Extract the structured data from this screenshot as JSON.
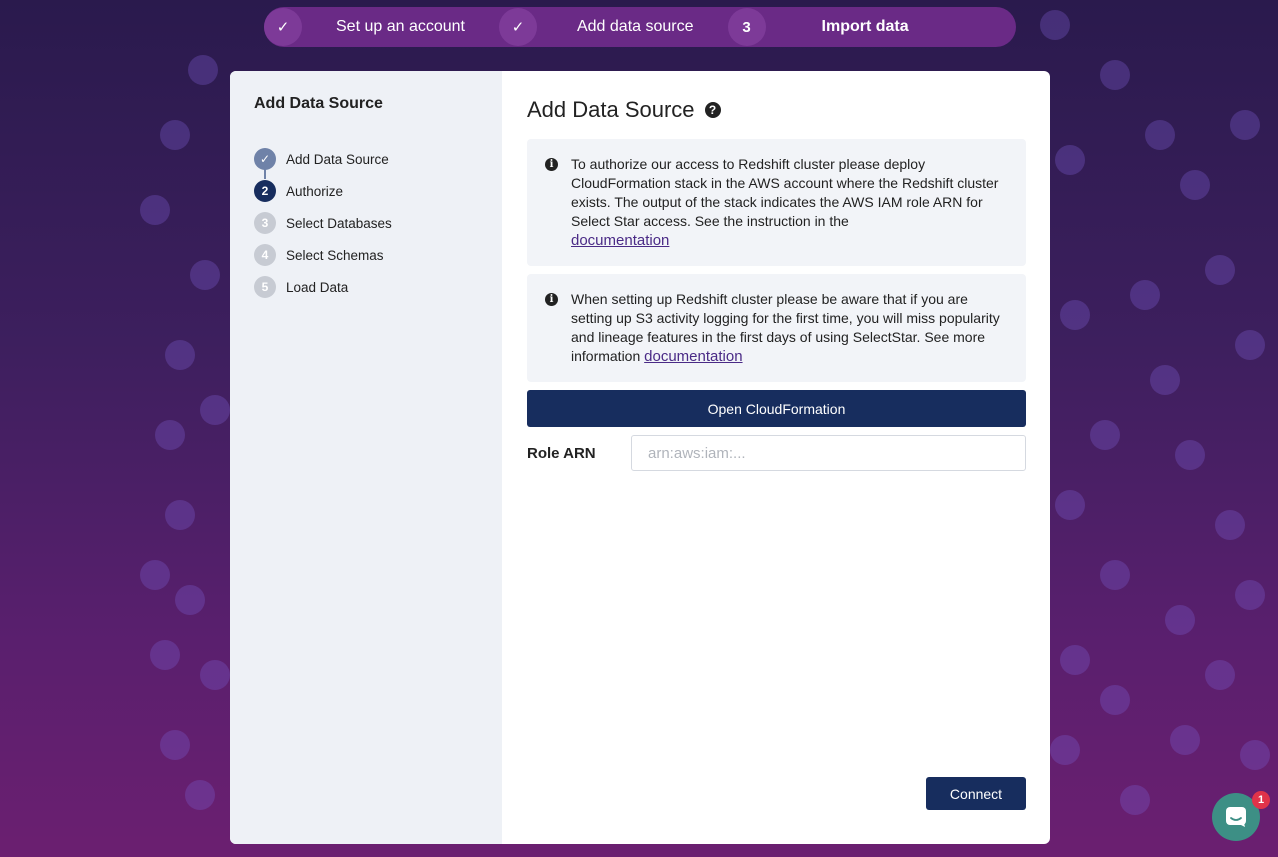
{
  "colors": {
    "primary": "#172d5e",
    "step_done": "#6f82a8",
    "link": "#4a2a86",
    "chat": "#3d8f85",
    "badge": "#e0334a"
  },
  "top_stepper": {
    "steps": [
      {
        "marker": "✓",
        "label": "Set up an account",
        "state": "done"
      },
      {
        "marker": "✓",
        "label": "Add data source",
        "state": "done"
      },
      {
        "marker": "3",
        "label": "Import data",
        "state": "active"
      }
    ]
  },
  "sidebar": {
    "title": "Add Data Source",
    "steps": [
      {
        "marker": "✓",
        "label": "Add Data Source",
        "state": "done"
      },
      {
        "marker": "2",
        "label": "Authorize",
        "state": "current"
      },
      {
        "marker": "3",
        "label": "Select Databases",
        "state": "todo"
      },
      {
        "marker": "4",
        "label": "Select Schemas",
        "state": "todo"
      },
      {
        "marker": "5",
        "label": "Load Data",
        "state": "todo"
      }
    ]
  },
  "main": {
    "title": "Add Data Source",
    "help_icon": "?",
    "notes": [
      {
        "icon": "info-icon",
        "text": "To authorize our access to Redshift cluster please deploy CloudFormation stack in the AWS account where the Redshift cluster exists. The output of the stack indicates the AWS IAM role ARN for Select Star access. See the instruction in the",
        "link": "documentation"
      },
      {
        "icon": "info-icon",
        "text": "When setting up Redshift cluster please be aware that if you are setting up S3 activity logging for the first time, you will miss popularity and lineage features in the first days of using SelectStar. See more information",
        "link": "documentation"
      }
    ],
    "open_button": "Open CloudFormation",
    "role_arn": {
      "label": "Role ARN",
      "placeholder": "arn:aws:iam:...",
      "value": ""
    },
    "connect_button": "Connect"
  },
  "chat": {
    "badge": "1"
  }
}
